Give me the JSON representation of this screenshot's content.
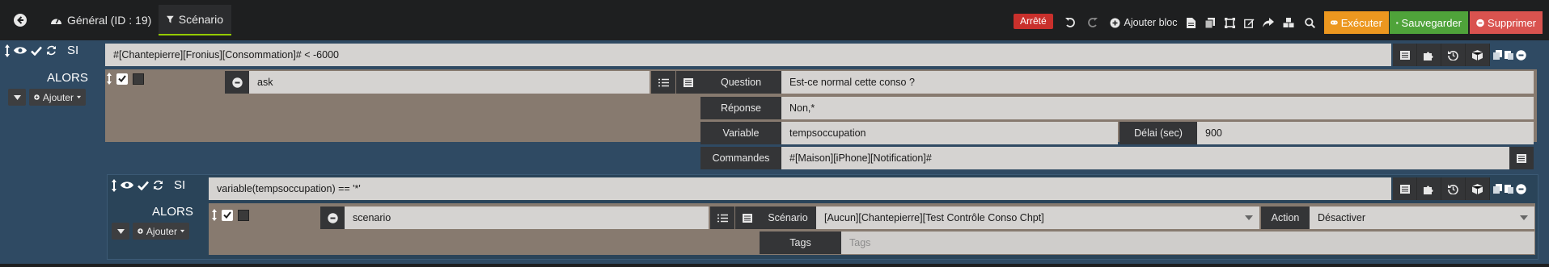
{
  "tabs": [
    {
      "label": "Général (ID : 19)"
    },
    {
      "label": "Scénario"
    }
  ],
  "status": "Arrêté",
  "toolbar": {
    "add_block": "Ajouter bloc",
    "execute": "Exécuter",
    "save": "Sauvegarder",
    "delete": "Supprimer"
  },
  "colors": {
    "execute": "#ec971f",
    "save": "#4fa33a",
    "delete": "#d9534f",
    "status": "#c9302c",
    "bloc": "#2f4a63",
    "action": "#877a6f"
  },
  "bloc1": {
    "si_label": "SI",
    "alors_label": "ALORS",
    "add_label": "Ajouter",
    "condition": "#[Chantepierre][Fronius][Consommation]# < -6000",
    "action": {
      "type": "ask",
      "question_label": "Question",
      "question_value": "Est-ce normal cette conso ?",
      "response_label": "Réponse",
      "response_value": "Non,*",
      "variable_label": "Variable",
      "variable_value": "tempsoccupation",
      "delay_label": "Délai (sec)",
      "delay_value": "900",
      "commands_label": "Commandes",
      "commands_value": "#[Maison][iPhone][Notification]#"
    }
  },
  "bloc2": {
    "si_label": "SI",
    "alors_label": "ALORS",
    "add_label": "Ajouter",
    "condition": "variable(tempsoccupation) == '*'",
    "action": {
      "type": "scenario",
      "scenario_label": "Scénario",
      "scenario_value": "[Aucun][Chantepierre][Test Contrôle Conso Chpt]",
      "action_label": "Action",
      "action_value": "Désactiver",
      "tags_label": "Tags",
      "tags_placeholder": "Tags"
    }
  }
}
